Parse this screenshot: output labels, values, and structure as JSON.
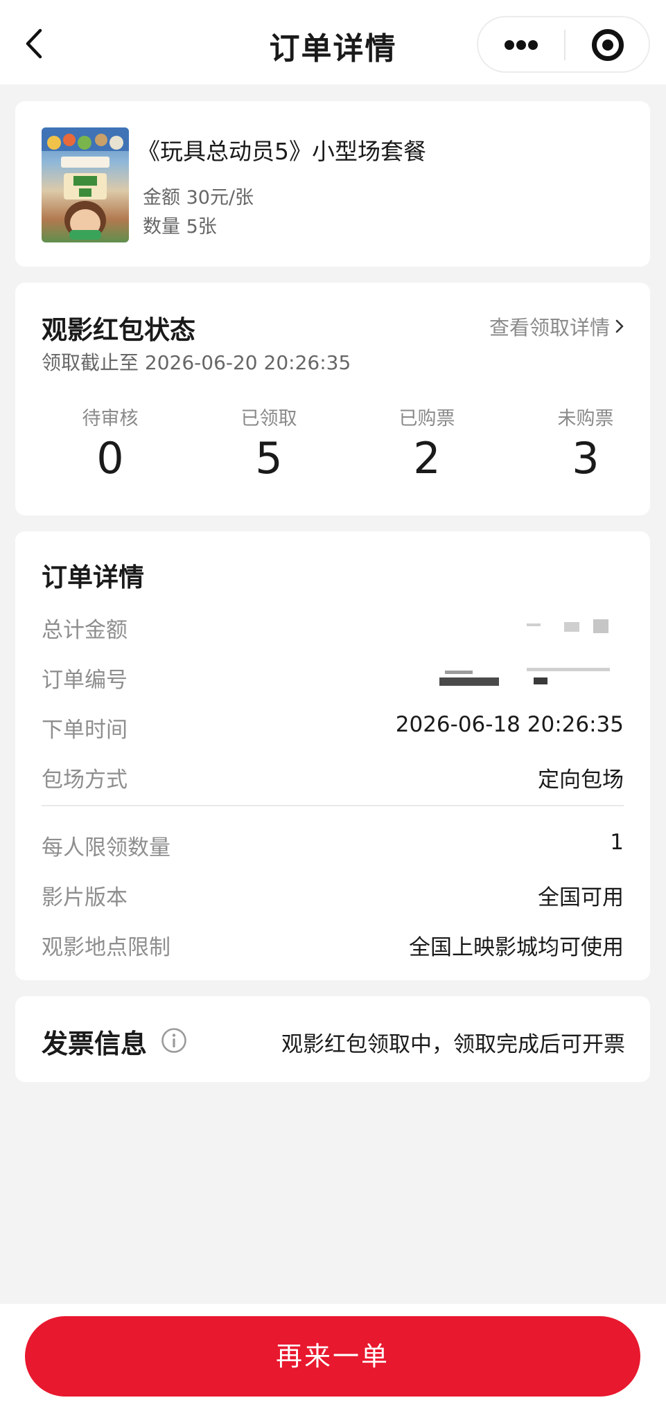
{
  "header": {
    "title": "订单详情"
  },
  "product": {
    "name": "《玩具总动员5》小型场套餐",
    "amount": "金额 30元/张",
    "quantity": "数量 5张"
  },
  "red_packet": {
    "title": "观影红包状态",
    "link_label": "查看领取详情",
    "deadline": "领取截止至 2026-06-20 20:26:35",
    "stats": [
      {
        "label": "待审核",
        "value": "0"
      },
      {
        "label": "已领取",
        "value": "5"
      },
      {
        "label": "已购票",
        "value": "2"
      },
      {
        "label": "未购票",
        "value": "3"
      }
    ]
  },
  "order_detail": {
    "title": "订单详情",
    "rows": [
      {
        "label": "总计金额",
        "value": ""
      },
      {
        "label": "订单编号",
        "value": ""
      },
      {
        "label": "下单时间",
        "value": "2026-06-18 20:26:35"
      },
      {
        "label": "包场方式",
        "value": "定向包场"
      },
      {
        "label": "每人限领数量",
        "value": "1"
      },
      {
        "label": "影片版本",
        "value": "全国可用"
      },
      {
        "label": "观影地点限制",
        "value": "全国上映影城均可使用"
      }
    ]
  },
  "invoice": {
    "title": "发票信息",
    "status": "观影红包领取中，领取完成后可开票"
  },
  "footer": {
    "reorder_label": "再来一单"
  },
  "colors": {
    "accent": "#e8182e",
    "background": "#f3f3f3"
  }
}
